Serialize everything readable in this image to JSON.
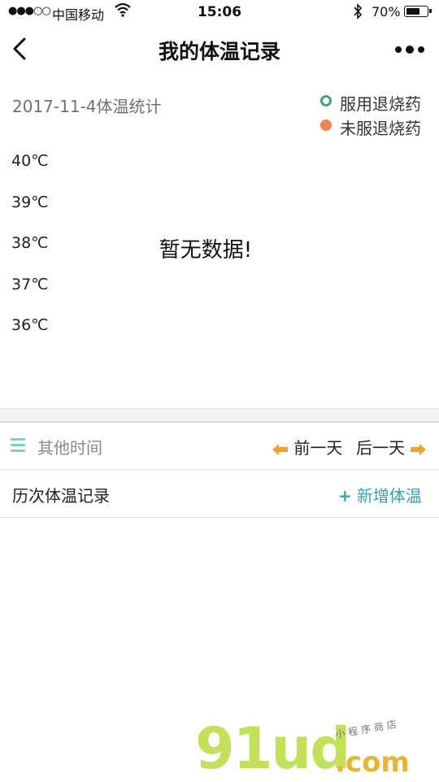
{
  "status_bar": {
    "signal": "●●●○○",
    "carrier": "中国移动",
    "time": "15:06",
    "battery_percent": "70%",
    "battery_level": 0.7,
    "icons": [
      "signal-dots-icon",
      "wifi-icon",
      "bluetooth-icon",
      "battery-icon"
    ]
  },
  "nav": {
    "title": "我的体温记录",
    "back_icon": "chevron-left-icon",
    "more_icon": "more-dots-icon"
  },
  "stats": {
    "date_label": "2017-11-4体温统计",
    "legend": [
      {
        "label": "服用退烧药",
        "color": "#3aa775",
        "style": "ring"
      },
      {
        "label": "未服退烧药",
        "color": "#f0834f",
        "style": "solid"
      }
    ],
    "y_axis": [
      "40℃",
      "39℃",
      "38℃",
      "37℃",
      "36℃"
    ],
    "empty_message": "暂无数据!"
  },
  "time_nav": {
    "other_time": "其他时间",
    "prev_day": "前一天",
    "next_day": "后一天",
    "accent_color": "#f0a030",
    "menu_color": "#7fcfd0"
  },
  "history": {
    "label": "历次体温记录",
    "add_plus": "+",
    "add_label": "新增体温",
    "accent_color": "#37a5a4"
  },
  "watermark": {
    "main": "91ud",
    "com": ".com",
    "sub": "小程序商店"
  }
}
